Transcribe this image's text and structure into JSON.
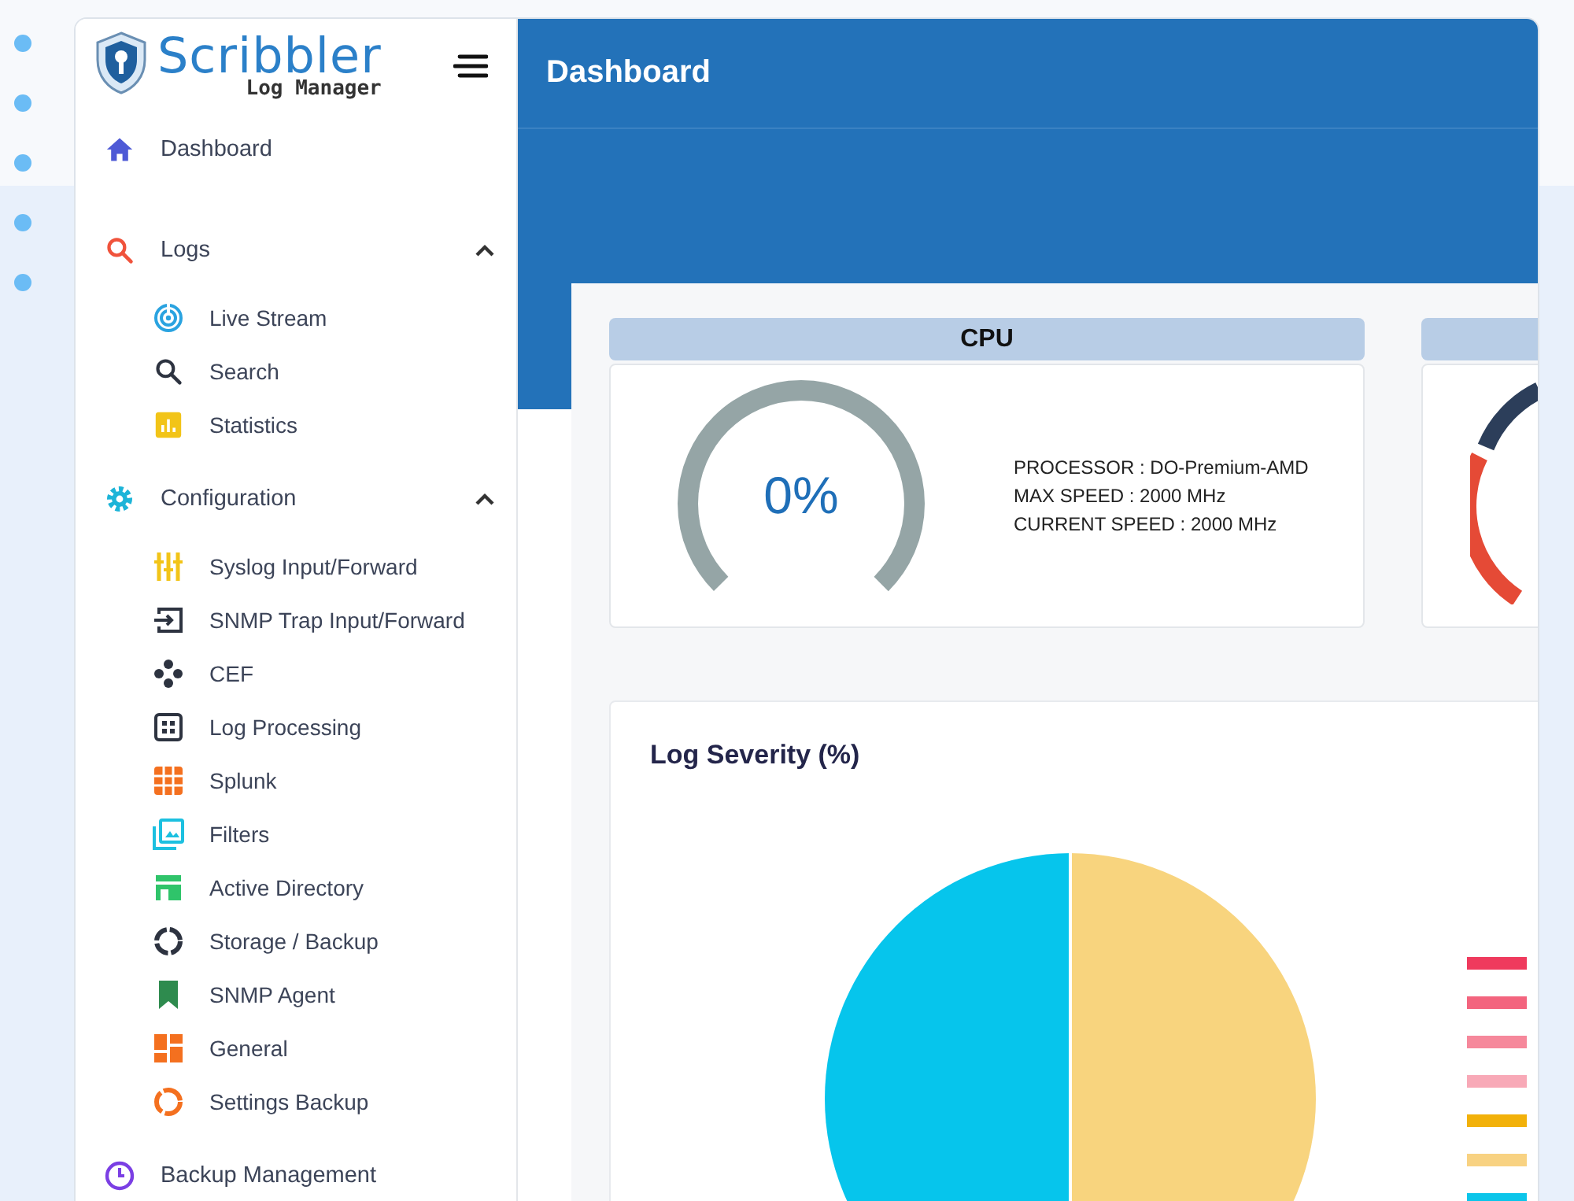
{
  "sidebar": {
    "logo": {
      "title": "Scribbler",
      "subtitle": "Log Manager"
    },
    "items": [
      {
        "label": "Dashboard"
      },
      {
        "label": "Logs",
        "expanded": true,
        "children": [
          {
            "label": "Live Stream"
          },
          {
            "label": "Search"
          },
          {
            "label": "Statistics"
          }
        ]
      },
      {
        "label": "Configuration",
        "expanded": true,
        "children": [
          {
            "label": "Syslog Input/Forward"
          },
          {
            "label": "SNMP Trap Input/Forward"
          },
          {
            "label": "CEF"
          },
          {
            "label": "Log Processing"
          },
          {
            "label": "Splunk"
          },
          {
            "label": "Filters"
          },
          {
            "label": "Active Directory"
          },
          {
            "label": "Storage / Backup"
          },
          {
            "label": "SNMP Agent"
          },
          {
            "label": "General"
          },
          {
            "label": "Settings Backup"
          }
        ]
      },
      {
        "label": "Backup Management"
      }
    ]
  },
  "header": {
    "title": "Dashboard"
  },
  "cpu_card": {
    "title": "CPU",
    "gauge": {
      "reading": "0%",
      "level": 0
    },
    "details": [
      "PROCESSOR : DO-Premium-AMD",
      "MAX SPEED : 2000 MHz",
      "CURRENT SPEED : 2000 MHz"
    ]
  },
  "log_severity": {
    "title": "Log Severity (%)",
    "legend": [
      {
        "color": "#ef3a5d"
      },
      {
        "color": "#f3647e"
      },
      {
        "color": "#f6889b"
      },
      {
        "color": "#f8a9b7"
      },
      {
        "color": "#f2b10a"
      },
      {
        "color": "#f8d282"
      },
      {
        "color": "#0bc5ea"
      }
    ]
  }
}
